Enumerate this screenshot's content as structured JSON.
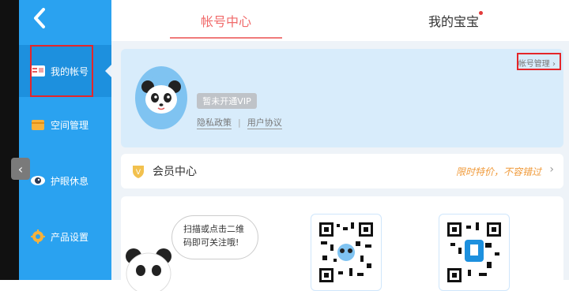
{
  "sidebar": {
    "back_icon": "chevron-left-icon",
    "items": [
      {
        "label": "我的帐号",
        "icon": "account-card-icon",
        "active": true
      },
      {
        "label": "空间管理",
        "icon": "folder-icon"
      },
      {
        "label": "护眼休息",
        "icon": "eye-icon"
      },
      {
        "label": "产品设置",
        "icon": "gear-icon"
      }
    ]
  },
  "tabs": [
    {
      "label": "帐号中心",
      "active": true
    },
    {
      "label": "我的宝宝",
      "has_dot": true
    }
  ],
  "profile": {
    "vip_status": "暂未开通VIP",
    "privacy_link": "隐私政策",
    "terms_link": "用户协议",
    "manage_link": "帐号管理"
  },
  "member": {
    "title": "会员中心",
    "promo": "限时特价，不容错过"
  },
  "qr_section": {
    "bubble_text": "扫描或点击二维码即可关注哦!"
  },
  "colors": {
    "sidebar": "#2aa2f0",
    "accent_red": "#e4262a",
    "tab_active": "#f06a6a",
    "promo": "#f09a3a"
  }
}
